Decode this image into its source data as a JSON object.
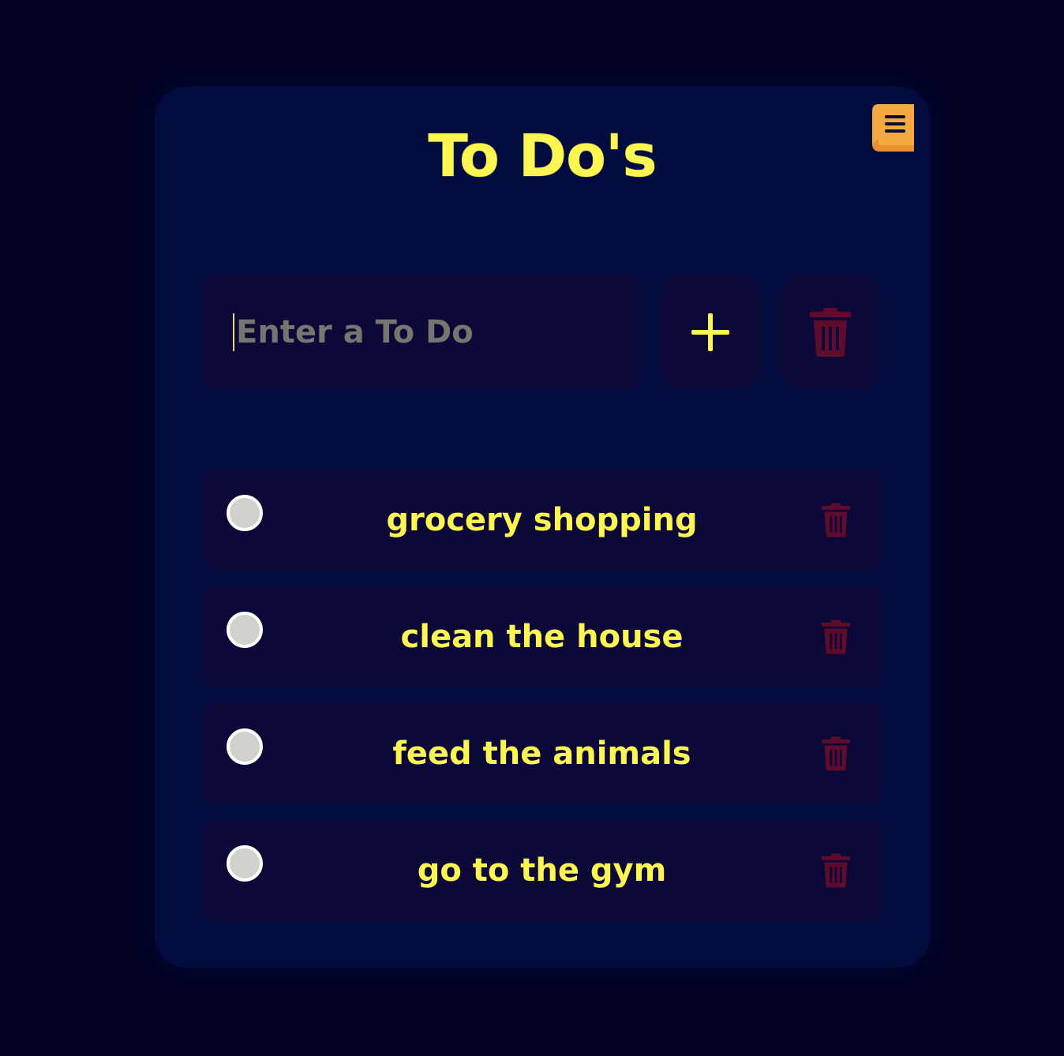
{
  "header": {
    "title": "To Do's",
    "book_icon": "book-icon"
  },
  "input": {
    "placeholder": "Enter a To Do",
    "value": ""
  },
  "buttons": {
    "add_icon": "plus-icon",
    "clear_icon": "trash-icon"
  },
  "todos": [
    {
      "text": "grocery shopping",
      "completed": false
    },
    {
      "text": "clean the house",
      "completed": false
    },
    {
      "text": "feed the animals",
      "completed": false
    },
    {
      "text": "go to the gym",
      "completed": false
    }
  ],
  "colors": {
    "background": "#010222",
    "card": "#020c3e",
    "panel": "#0c0838",
    "accent": "#fdf552",
    "book": "#f5a942",
    "trash": "#5e0b2c",
    "placeholder": "#77756f"
  }
}
